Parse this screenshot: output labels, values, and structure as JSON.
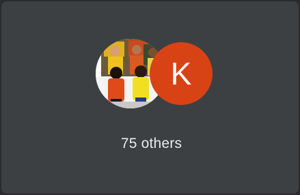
{
  "participants_tile": {
    "avatars": [
      {
        "kind": "photo",
        "icon": "participant-photo"
      },
      {
        "kind": "initial",
        "initial": "K",
        "color": "#d84315"
      }
    ],
    "others_label": "75 others"
  },
  "colors": {
    "tile_background": "#3c4043",
    "text": "#e8eaed"
  }
}
